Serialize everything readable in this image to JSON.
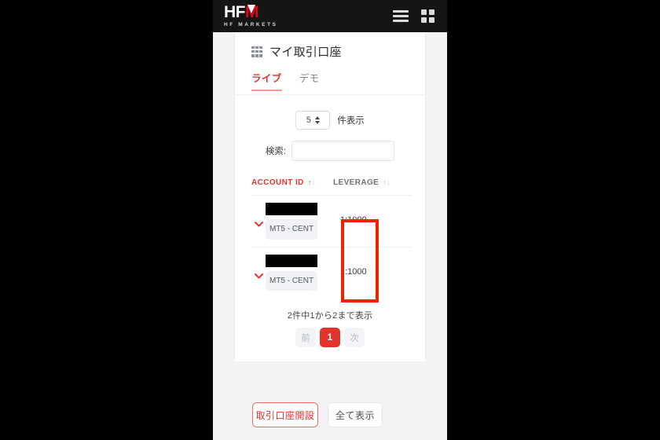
{
  "appbar": {
    "logo_main_white": "HF",
    "logo_main_red": "M",
    "logo_sub": "HF MARKETS",
    "menu_icon": "hamburger-menu-icon",
    "grid_icon": "grid-apps-icon"
  },
  "page": {
    "title": "マイ取引口座",
    "title_icon": "grid-dots-icon"
  },
  "tabs": [
    {
      "label": "ライブ",
      "active": true
    },
    {
      "label": "デモ",
      "active": false
    }
  ],
  "controls": {
    "page_length_value": "5",
    "page_length_label": "件表示",
    "page_length_options": [
      "5"
    ],
    "search_label": "検索:",
    "search_value": "",
    "search_placeholder": ""
  },
  "table": {
    "columns": [
      {
        "label": "ACCOUNT ID",
        "sort_state": "asc",
        "active": true
      },
      {
        "label": "LEVERAGE",
        "sort_state": "none",
        "active": false
      }
    ],
    "rows": [
      {
        "expander_icon": "chevron-down-icon",
        "account_id": "",
        "account_id_redacted": true,
        "platform_badge": "MT5 - CENT",
        "leverage": "1:1000"
      },
      {
        "expander_icon": "chevron-down-icon",
        "account_id": "",
        "account_id_redacted": true,
        "platform_badge": "MT5 - CENT",
        "leverage": "1:1000"
      }
    ]
  },
  "pagination": {
    "info": "2件中1から2まで表示",
    "prev_label": "前",
    "current_page": "1",
    "next_label": "次"
  },
  "actions": {
    "open_account_label": "取引口座開設",
    "show_all_label": "全て表示"
  },
  "annotation": {
    "shape": "rectangle-highlight",
    "color": "#ef2200"
  },
  "colors": {
    "brand_red": "#e2342d",
    "appbar_black": "#151515",
    "page_bg": "#f3f3f5",
    "card_bg": "#ffffff",
    "annotation_red": "#ef2200"
  }
}
